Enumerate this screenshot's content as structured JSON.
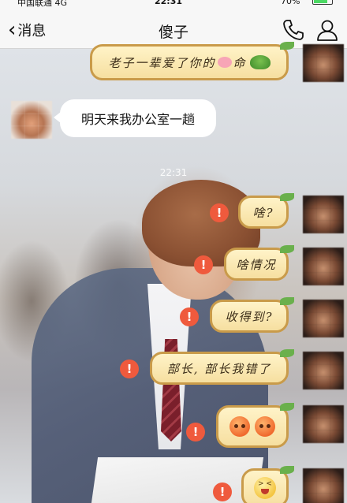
{
  "status_bar": {
    "carrier": "中国联通 4G",
    "time": "22:31",
    "battery": "70%"
  },
  "nav": {
    "back_label": "消息",
    "title": "傻子"
  },
  "icons": {
    "back": "chevron-left-icon",
    "call": "phone-icon",
    "profile": "person-icon",
    "error": "exclamation-icon"
  },
  "messages": {
    "top_sent": "老子一辈爱了你的",
    "top_sent_suffix": "命",
    "received": "明天来我办公室一趟",
    "timestamp": "22:31",
    "sent": [
      "啥?",
      "啥情况",
      "收得到?",
      "部长, 部长我错了"
    ]
  },
  "colors": {
    "error_red": "#ef5a3d",
    "bubble_fill": "#fff3c8",
    "bubble_border": "#c99b4a"
  }
}
